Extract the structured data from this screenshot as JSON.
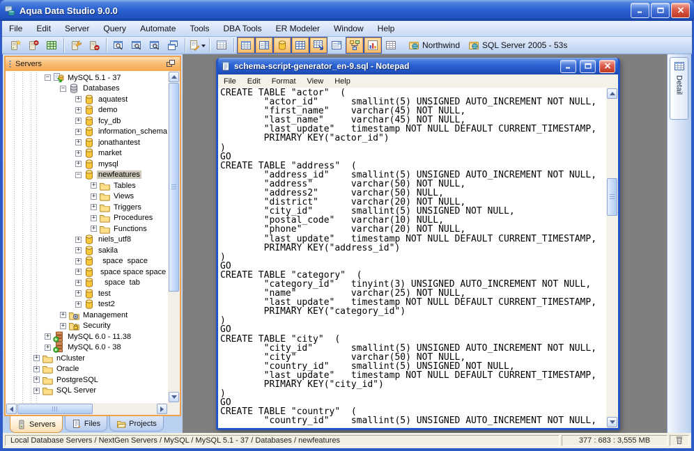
{
  "window": {
    "title": "Aqua Data Studio 9.0.0"
  },
  "menubar": {
    "items": [
      "File",
      "Edit",
      "Server",
      "Query",
      "Automate",
      "Tools",
      "DBA Tools",
      "ER Modeler",
      "Window",
      "Help"
    ]
  },
  "toolbar": {
    "buttons": [
      {
        "name": "register-server-button",
        "icon": "server-add-icon"
      },
      {
        "name": "unregister-server-button",
        "icon": "server-remove-icon"
      },
      {
        "name": "connect-server-button",
        "icon": "green-grid-icon"
      },
      {
        "sep": true
      },
      {
        "name": "server-properties-button",
        "icon": "server-tools-icon"
      },
      {
        "name": "disconnect-server-button",
        "icon": "server-stop-icon"
      },
      {
        "sep": true
      },
      {
        "name": "query-analyzer-button",
        "icon": "query-window-icon"
      },
      {
        "name": "query-analyzer-results-button",
        "icon": "query-window-results-icon"
      },
      {
        "name": "query-analyzer-grid-button",
        "icon": "query-window-grid-icon"
      },
      {
        "name": "cascade-windows-button",
        "icon": "cascade-windows-icon"
      },
      {
        "sep": true
      },
      {
        "name": "open-script-button",
        "icon": "script-edit-icon",
        "dropdown": true
      },
      {
        "sep": true
      },
      {
        "name": "schema-browser-button",
        "icon": "schema-browser-icon"
      },
      {
        "sep": true
      },
      {
        "name": "toggle-grid-results-button",
        "icon": "grid-icon",
        "toggled": true
      },
      {
        "name": "toggle-text-results-button",
        "icon": "grid-panel-icon",
        "toggled": true
      },
      {
        "name": "toggle-db-objects-button",
        "icon": "db-cylinder-icon",
        "toggled": true
      },
      {
        "name": "toggle-table-grid-button",
        "icon": "grid2-icon",
        "toggled": true
      },
      {
        "name": "toggle-pivot-grid-button",
        "icon": "grid-arrow-icon",
        "toggled": true
      },
      {
        "name": "toggle-form-view-button",
        "icon": "form-icon"
      },
      {
        "name": "toggle-er-view-button",
        "icon": "er-diagram-icon",
        "toggled": true
      },
      {
        "name": "toggle-chart-view-button",
        "icon": "bar-chart-icon",
        "toggled": true
      },
      {
        "name": "toggle-table-view-button",
        "icon": "table-icon"
      }
    ],
    "connections": [
      {
        "icon": "connection-icon",
        "label": "Northwind"
      },
      {
        "icon": "connection-icon",
        "label": "SQL Server 2005 - 53s"
      }
    ]
  },
  "sidebar": {
    "title": "Servers",
    "tabs": [
      {
        "label": "Servers",
        "icon": "servers-tab-icon",
        "active": true
      },
      {
        "label": "Files",
        "icon": "files-tab-icon",
        "active": false
      },
      {
        "label": "Projects",
        "icon": "projects-tab-icon",
        "active": false
      }
    ],
    "tree": [
      {
        "label": "MySQL 5.1 - 37",
        "icon": "mysql-server-icon",
        "depth": 4,
        "expand": "collapse"
      },
      {
        "label": "Databases",
        "icon": "databases-icon",
        "depth": 5,
        "expand": "collapse"
      },
      {
        "label": "aquatest",
        "icon": "database-icon",
        "depth": 6,
        "expand": "expand"
      },
      {
        "label": "demo",
        "icon": "database-icon",
        "depth": 6,
        "expand": "expand"
      },
      {
        "label": "fcy_db",
        "icon": "database-icon",
        "depth": 6,
        "expand": "expand"
      },
      {
        "label": "information_schema",
        "icon": "database-icon",
        "depth": 6,
        "expand": "expand"
      },
      {
        "label": "jonathantest",
        "icon": "database-icon",
        "depth": 6,
        "expand": "expand"
      },
      {
        "label": "market",
        "icon": "database-icon",
        "depth": 6,
        "expand": "expand"
      },
      {
        "label": "mysql",
        "icon": "database-icon",
        "depth": 6,
        "expand": "expand"
      },
      {
        "label": "newfeatures",
        "icon": "database-icon",
        "depth": 6,
        "expand": "collapse",
        "selected": true
      },
      {
        "label": "Tables",
        "icon": "folder-icon",
        "depth": 7,
        "expand": "expand"
      },
      {
        "label": "Views",
        "icon": "folder-icon",
        "depth": 7,
        "expand": "expand"
      },
      {
        "label": "Triggers",
        "icon": "folder-icon",
        "depth": 7,
        "expand": "expand"
      },
      {
        "label": "Procedures",
        "icon": "folder-icon",
        "depth": 7,
        "expand": "expand"
      },
      {
        "label": "Functions",
        "icon": "folder-icon",
        "depth": 7,
        "expand": "expand"
      },
      {
        "label": "niels_utf8",
        "icon": "database-icon",
        "depth": 6,
        "expand": "expand"
      },
      {
        "label": "sakila",
        "icon": "database-icon",
        "depth": 6,
        "expand": "expand"
      },
      {
        "label": "  space  space",
        "icon": "database-icon",
        "depth": 6,
        "expand": "expand"
      },
      {
        "label": " space space space",
        "icon": "database-icon",
        "depth": 6,
        "expand": "expand"
      },
      {
        "label": "   space  tab",
        "icon": "database-icon",
        "depth": 6,
        "expand": "expand"
      },
      {
        "label": "test",
        "icon": "database-icon",
        "depth": 6,
        "expand": "expand"
      },
      {
        "label": "test2",
        "icon": "database-icon",
        "depth": 6,
        "expand": "expand"
      },
      {
        "label": "Management",
        "icon": "folder-gear-icon",
        "depth": 5,
        "expand": "expand"
      },
      {
        "label": "Security",
        "icon": "folder-lock-icon",
        "depth": 5,
        "expand": "expand"
      },
      {
        "label": "MySQL 6.0 - 11.38",
        "icon": "mysql6-server-icon",
        "depth": 4,
        "expand": "expand"
      },
      {
        "label": "MySQL 6.0 - 38",
        "icon": "mysql6-server-icon",
        "depth": 4,
        "expand": "expand"
      },
      {
        "label": "nCluster",
        "icon": "folder-icon",
        "depth": 3,
        "expand": "expand"
      },
      {
        "label": "Oracle",
        "icon": "folder-icon",
        "depth": 3,
        "expand": "expand"
      },
      {
        "label": "PostgreSQL",
        "icon": "folder-icon",
        "depth": 3,
        "expand": "expand"
      },
      {
        "label": "SQL Server",
        "icon": "folder-icon",
        "depth": 3,
        "expand": "expand"
      }
    ]
  },
  "detail_panel": {
    "label": "Detail"
  },
  "notepad": {
    "title": "schema-script-generator_en-9.sql - Notepad",
    "menu": [
      "File",
      "Edit",
      "Format",
      "View",
      "Help"
    ],
    "content_lines": [
      "CREATE TABLE \"actor\"  (",
      "        \"actor_id\"      smallint(5) UNSIGNED AUTO_INCREMENT NOT NULL,",
      "        \"first_name\"    varchar(45) NOT NULL,",
      "        \"last_name\"     varchar(45) NOT NULL,",
      "        \"last_update\"   timestamp NOT NULL DEFAULT CURRENT_TIMESTAMP,",
      "        PRIMARY KEY(\"actor_id\")",
      ")",
      "GO",
      "CREATE TABLE \"address\"  (",
      "        \"address_id\"    smallint(5) UNSIGNED AUTO_INCREMENT NOT NULL,",
      "        \"address\"       varchar(50) NOT NULL,",
      "        \"address2\"      varchar(50) NULL,",
      "        \"district\"      varchar(20) NOT NULL,",
      "        \"city_id\"       smallint(5) UNSIGNED NOT NULL,",
      "        \"postal_code\"   varchar(10) NULL,",
      "        \"phone\"         varchar(20) NOT NULL,",
      "        \"last_update\"   timestamp NOT NULL DEFAULT CURRENT_TIMESTAMP,",
      "        PRIMARY KEY(\"address_id\")",
      ")",
      "GO",
      "CREATE TABLE \"category\"  (",
      "        \"category_id\"   tinyint(3) UNSIGNED AUTO_INCREMENT NOT NULL,",
      "        \"name\"          varchar(25) NOT NULL,",
      "        \"last_update\"   timestamp NOT NULL DEFAULT CURRENT_TIMESTAMP,",
      "        PRIMARY KEY(\"category_id\")",
      ")",
      "GO",
      "CREATE TABLE \"city\"  (",
      "        \"city_id\"       smallint(5) UNSIGNED AUTO_INCREMENT NOT NULL,",
      "        \"city\"          varchar(50) NOT NULL,",
      "        \"country_id\"    smallint(5) UNSIGNED NOT NULL,",
      "        \"last_update\"   timestamp NOT NULL DEFAULT CURRENT_TIMESTAMP,",
      "        PRIMARY KEY(\"city_id\")",
      ")",
      "GO",
      "CREATE TABLE \"country\"  (",
      "        \"country_id\"    smallint(5) UNSIGNED AUTO_INCREMENT NOT NULL,"
    ]
  },
  "statusbar": {
    "breadcrumb": "Local Database Servers / NextGen Servers / MySQL / MySQL 5.1 - 37 / Databases / newfeatures",
    "memory": "377 : 683 : 3,555 MB"
  },
  "colors": {
    "titlebar_blue": "#2B62D2",
    "panel_orange": "#EFA24B",
    "toggle_orange": "#F7BC6C",
    "mdi_gray": "#7F7F7F",
    "selection_gray": "#CDC9BA"
  }
}
